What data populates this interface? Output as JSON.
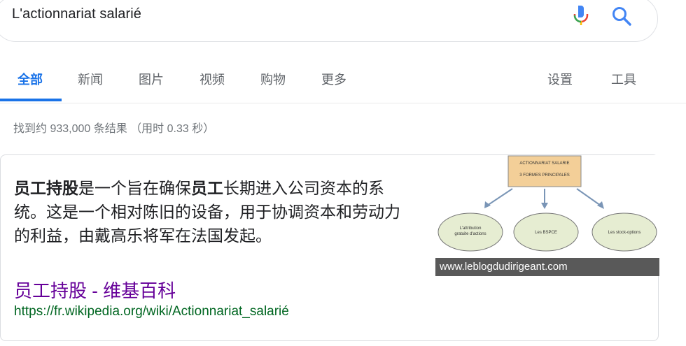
{
  "search": {
    "query": "L'actionnariat salarié"
  },
  "tabs": [
    {
      "label": "全部"
    },
    {
      "label": "新闻"
    },
    {
      "label": "图片"
    },
    {
      "label": "视频"
    },
    {
      "label": "购物"
    },
    {
      "label": "更多"
    },
    {
      "label": "设置"
    },
    {
      "label": "工具"
    }
  ],
  "result_stats": "找到约 933,000 条结果 （用时 0.33 秒）",
  "snippet": {
    "bold_1": "员工持股",
    "text_1": "是一个旨在确保",
    "bold_2": "员工",
    "text_2": "长期进入公司资本的系统。这是一个相对陈旧的设备，用于协调资本和劳动力的利益，由戴高乐将军在法国发起。",
    "image": {
      "header_line_1": "ACTIONNARIAT SALARIE",
      "header_line_2": "3 FORMES PRINCIPALES",
      "ellipse_1_line_1": "L'attribution",
      "ellipse_1_line_2": "gratuite d'actions",
      "ellipse_2": "Les BSPCE",
      "ellipse_3": "Les stock-options",
      "caption": "www.leblogdudirigeant.com"
    },
    "result_title": "员工持股 - 维基百科",
    "result_url": "https://fr.wikipedia.org/wiki/Actionnariat_salarié"
  },
  "colors": {
    "accent": "#1a73e8",
    "visited_link": "#660099",
    "url_green": "#006621",
    "box_fill": "#f3cf98",
    "ellipse_fill": "#e6edd2"
  }
}
